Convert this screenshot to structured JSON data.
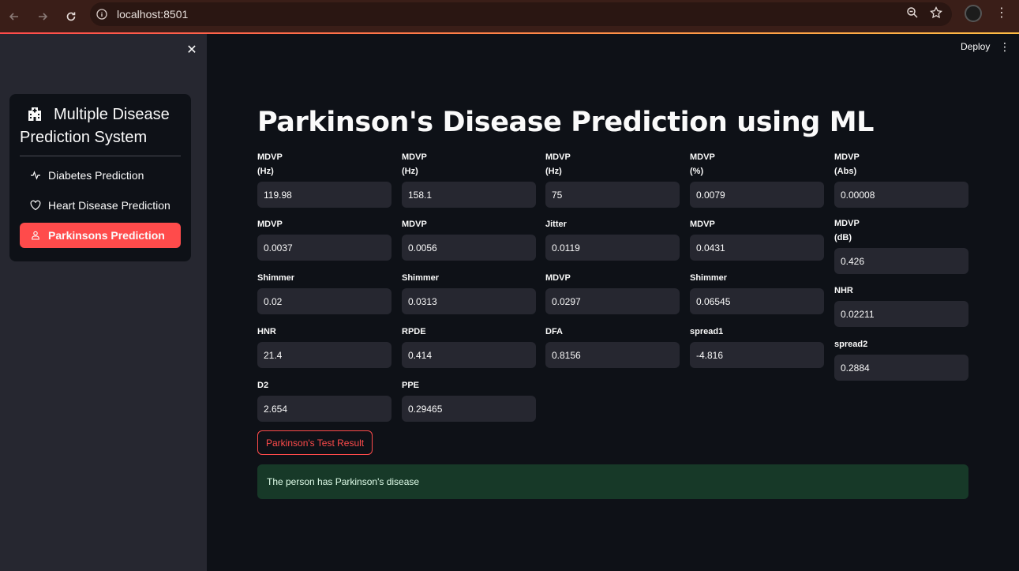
{
  "browser": {
    "url": "localhost:8501"
  },
  "sidebar": {
    "app_title": "Multiple Disease Prediction System",
    "app_title_line1": "Multiple Disease",
    "app_title_line2": "Prediction System",
    "items": [
      {
        "label": "Diabetes Prediction",
        "icon": "activity-icon",
        "selected": false
      },
      {
        "label": "Heart Disease Prediction",
        "icon": "heart-icon",
        "selected": false
      },
      {
        "label": "Parkinsons Prediction",
        "icon": "person-icon",
        "selected": true
      }
    ]
  },
  "header": {
    "deploy_label": "Deploy"
  },
  "main": {
    "title": "Parkinson's Disease Prediction using ML",
    "fields": [
      {
        "line1": "MDVP",
        "line2": "(Hz)",
        "value": "119.98"
      },
      {
        "line1": "MDVP",
        "line2": "(Hz)",
        "value": "158.1"
      },
      {
        "line1": "MDVP",
        "line2": "(Hz)",
        "value": "75"
      },
      {
        "line1": "MDVP",
        "line2": "(%)",
        "value": "0.0079"
      },
      {
        "line1": "MDVP",
        "line2": "(Abs)",
        "value": "0.00008"
      },
      {
        "line1": "MDVP",
        "line2": "",
        "value": "0.0037"
      },
      {
        "line1": "MDVP",
        "line2": "",
        "value": "0.0056"
      },
      {
        "line1": "Jitter",
        "line2": "",
        "value": "0.0119"
      },
      {
        "line1": "MDVP",
        "line2": "",
        "value": "0.0431"
      },
      {
        "line1": "MDVP",
        "line2": "(dB)",
        "value": "0.426"
      },
      {
        "line1": "Shimmer",
        "line2": "",
        "value": "0.02"
      },
      {
        "line1": "Shimmer",
        "line2": "",
        "value": "0.0313"
      },
      {
        "line1": "MDVP",
        "line2": "",
        "value": "0.0297"
      },
      {
        "line1": "Shimmer",
        "line2": "",
        "value": "0.06545"
      },
      {
        "line1": "NHR",
        "line2": "",
        "value": "0.02211"
      },
      {
        "line1": "HNR",
        "line2": "",
        "value": "21.4"
      },
      {
        "line1": "RPDE",
        "line2": "",
        "value": "0.414"
      },
      {
        "line1": "DFA",
        "line2": "",
        "value": "0.8156"
      },
      {
        "line1": "spread1",
        "line2": "",
        "value": "-4.816"
      },
      {
        "line1": "spread2",
        "line2": "",
        "value": "0.2884"
      },
      {
        "line1": "D2",
        "line2": "",
        "value": "2.654"
      },
      {
        "line1": "PPE",
        "line2": "",
        "value": "0.29465"
      }
    ],
    "button_label": "Parkinson's Test Result",
    "result_text": "The person has Parkinson's disease"
  },
  "colors": {
    "accent": "#ff4b4b",
    "sidebar_bg": "#262730",
    "main_bg": "#0e1117",
    "success_bg": "#173928"
  }
}
